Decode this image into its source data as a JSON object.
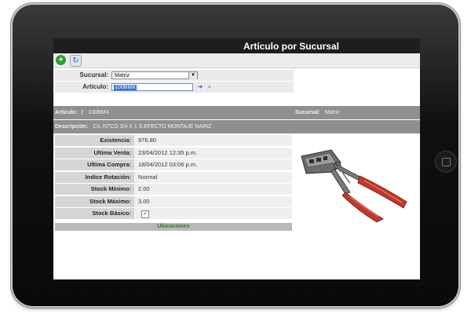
{
  "window": {
    "title": "Artículo por Sucursal"
  },
  "toolbar": {
    "add_icon": "plus-circle-icon",
    "refresh_icon": "refresh-icon"
  },
  "form": {
    "sucursal_label": "Sucursal:",
    "sucursal_value": "Matriz",
    "articulo_label": "Artículo:",
    "articulo_value": "100BMX"
  },
  "info": {
    "articulo_label": "Artículo:",
    "articulo_number": "2",
    "articulo_code": "100BMX",
    "sucursal_label": "Sucursal:",
    "sucursal_value": "Matriz",
    "descripcion_label": "Descripción:",
    "descripcion_value": "CIL NTCO 3/4 X 1 S.EFECTO MONTAJE NARIZ"
  },
  "details": [
    {
      "label": "Existencia:",
      "value": "976.80"
    },
    {
      "label": "Ultima Venta:",
      "value": "23/04/2012 12:35 p.m."
    },
    {
      "label": "Ultima Compra:",
      "value": "18/04/2012 03:06 p.m."
    },
    {
      "label": "Indice Rotación:",
      "value": "Normal"
    },
    {
      "label": "Stock Mínimo:",
      "value": "2.00"
    },
    {
      "label": "Stock Máximo:",
      "value": "3.00"
    },
    {
      "label": "Stock Básico:",
      "value": "✓"
    }
  ],
  "ubicaciones_label": "Ubicaciones",
  "colors": {
    "title_bg": "#1e1e1e",
    "band_bg": "#8f8f8f",
    "accent_green": "#2e7d22",
    "handle_red": "#c0392b"
  }
}
